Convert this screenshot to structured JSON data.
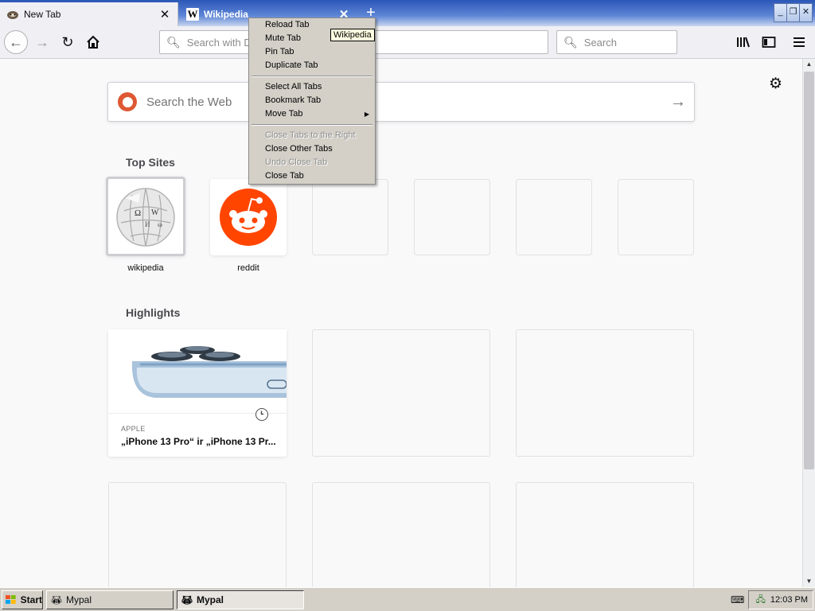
{
  "tabs": [
    {
      "title": "New Tab",
      "close": "✕"
    },
    {
      "title": "Wikipedia",
      "close": "✕"
    }
  ],
  "newtab_symbol": "+",
  "window_controls": {
    "minimize": "_",
    "restore": "❐",
    "close": "✕"
  },
  "navbar": {
    "urlbar_placeholder": "Search with D",
    "searchbar_placeholder": "Search"
  },
  "page": {
    "websearch_placeholder": "Search the Web",
    "topsites_title": "Top Sites",
    "highlights_title": "Highlights",
    "top_sites": [
      {
        "label": "wikipedia",
        "icon": "wikipedia-globe-icon"
      },
      {
        "label": "reddit",
        "icon": "reddit-alien-icon"
      }
    ],
    "highlight_card": {
      "source": "APPLE",
      "headline": "„iPhone 13 Pro“ ir „iPhone 13 Pr..."
    }
  },
  "context_menu": {
    "items": [
      {
        "label": "Reload Tab",
        "enabled": true
      },
      {
        "label": "Mute Tab",
        "enabled": true
      },
      {
        "label": "Pin Tab",
        "enabled": true
      },
      {
        "label": "Duplicate Tab",
        "enabled": true
      },
      {
        "label": "Select All Tabs",
        "enabled": true
      },
      {
        "label": "Bookmark Tab",
        "enabled": true
      },
      {
        "label": "Move Tab",
        "enabled": true,
        "submenu": true
      },
      {
        "label": "Close Tabs to the Right",
        "enabled": false
      },
      {
        "label": "Close Other Tabs",
        "enabled": true
      },
      {
        "label": "Undo Close Tab",
        "enabled": false
      },
      {
        "label": "Close Tab",
        "enabled": true
      }
    ]
  },
  "tooltip": "Wikipedia",
  "taskbar": {
    "start_label": "Start",
    "tasks": [
      {
        "label": "Mypal"
      },
      {
        "label": "Mypal"
      }
    ],
    "clock": "12:03 PM"
  },
  "colors": {
    "reddit": "#ff4500",
    "duckduckgo": "#de5833",
    "titlebar": "#2b57b8"
  }
}
